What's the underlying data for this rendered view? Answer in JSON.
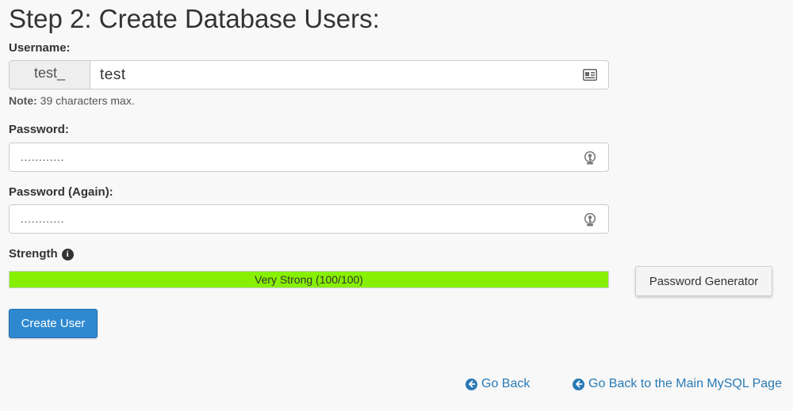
{
  "heading": "Step 2: Create Database Users:",
  "username": {
    "label": "Username:",
    "prefix": "test_",
    "value": "test",
    "note_bold": "Note:",
    "note_text": " 39 characters max."
  },
  "password": {
    "label": "Password:",
    "value": "............"
  },
  "password_again": {
    "label": "Password (Again):",
    "value": "............"
  },
  "strength": {
    "label": "Strength",
    "text": "Very Strong (100/100)",
    "score": 100,
    "max": 100,
    "color": "#87f000"
  },
  "buttons": {
    "password_generator": "Password Generator",
    "create_user": "Create User"
  },
  "links": {
    "go_back": "Go Back",
    "go_back_main": "Go Back to the Main MySQL Page"
  },
  "icons": {
    "username_field": "contact-card-icon",
    "password_field": "key-icon",
    "strength_info": "info-icon",
    "link_arrow": "arrow-left-circle-icon"
  }
}
